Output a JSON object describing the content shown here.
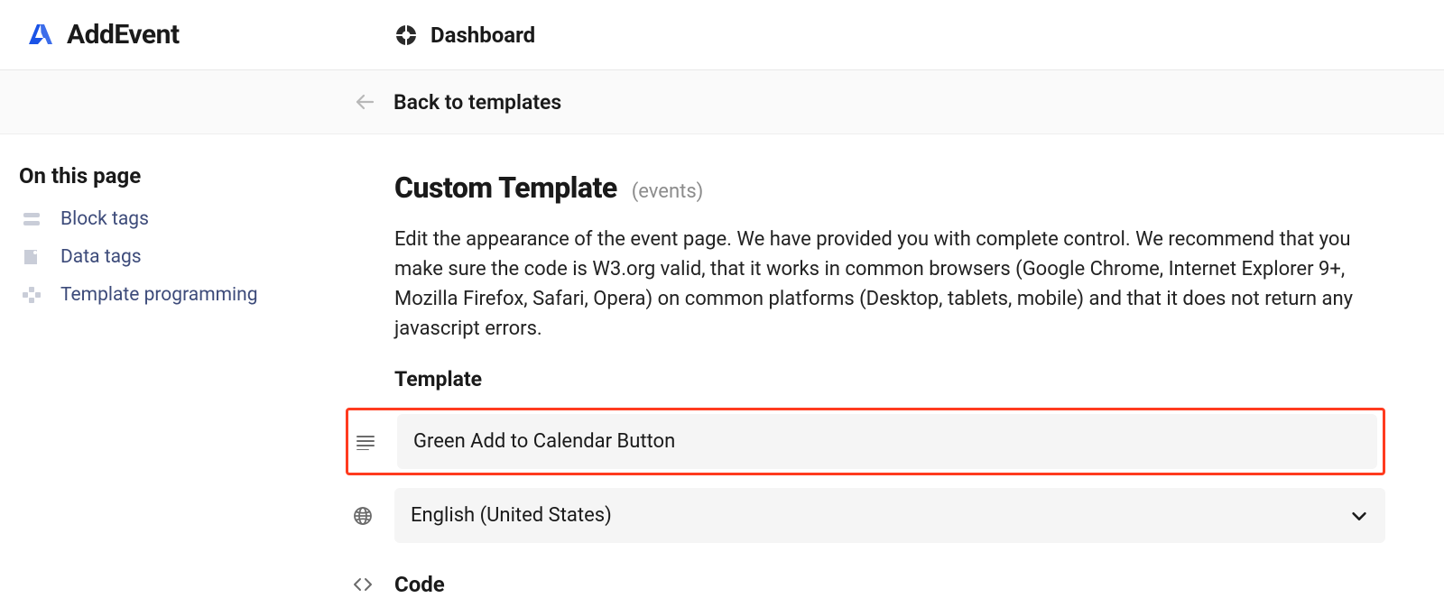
{
  "brand": {
    "name": "AddEvent"
  },
  "header": {
    "dashboard_label": "Dashboard",
    "back_label": "Back to templates"
  },
  "sidebar": {
    "title": "On this page",
    "items": [
      {
        "label": "Block tags"
      },
      {
        "label": "Data tags"
      },
      {
        "label": "Template programming"
      }
    ]
  },
  "main": {
    "title": "Custom Template",
    "title_suffix": "(events)",
    "description": "Edit the appearance of the event page. We have provided you with complete control. We recommend that you make sure the code is W3.org valid, that it works in common browsers (Google Chrome, Internet Explorer 9+, Mozilla Firefox, Safari, Opera) on common platforms (Desktop, tablets, mobile) and that it does not return any javascript errors.",
    "template_section_label": "Template",
    "template_name_value": "Green Add to Calendar Button",
    "language_value": "English (United States)",
    "code_section_label": "Code"
  }
}
